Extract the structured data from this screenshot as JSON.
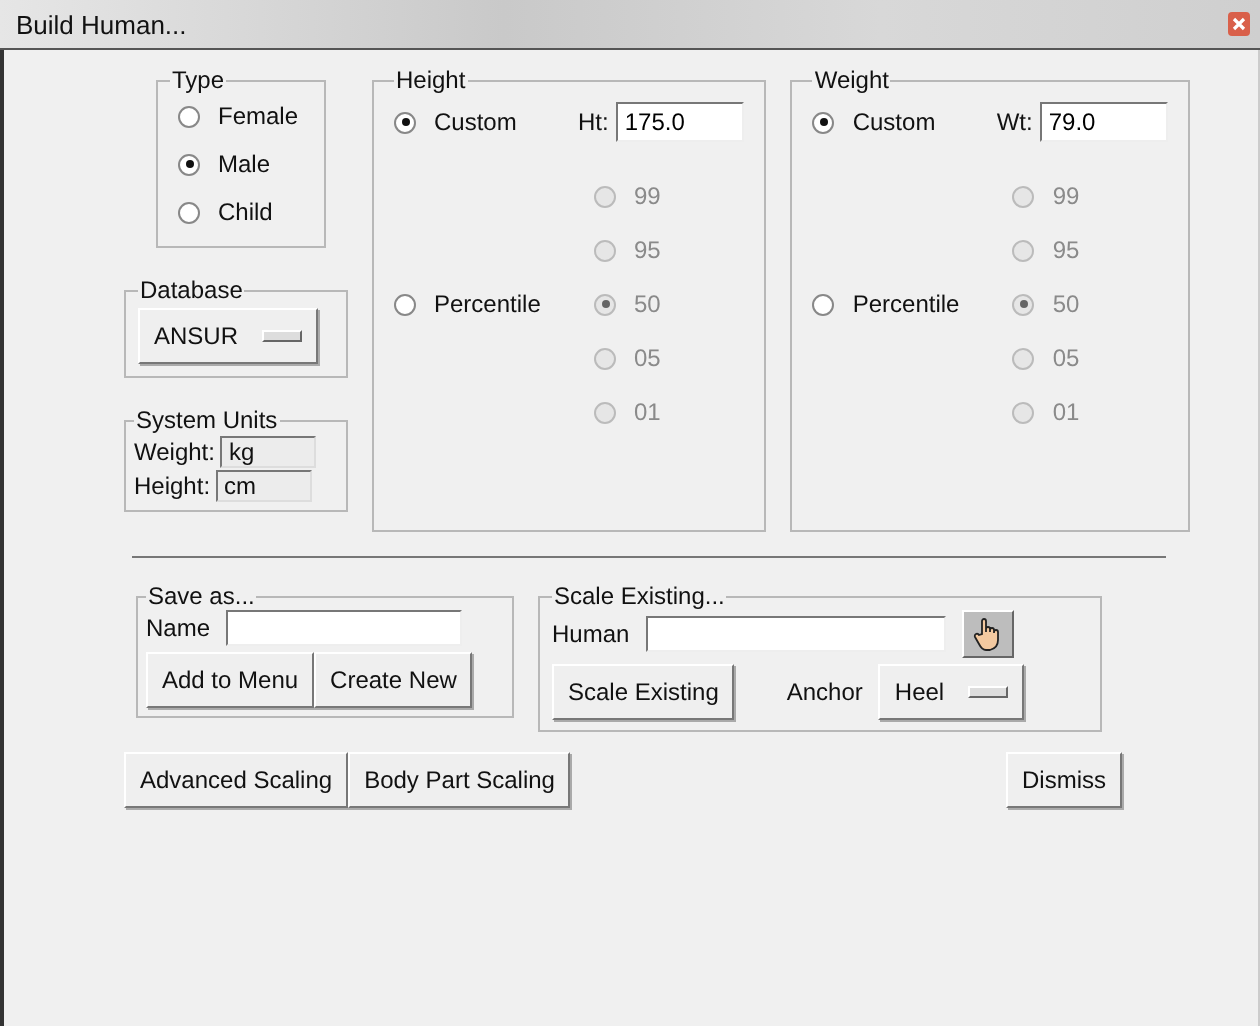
{
  "window": {
    "title": "Build Human..."
  },
  "type": {
    "legend": "Type",
    "options": [
      {
        "label": "Female",
        "selected": false
      },
      {
        "label": "Male",
        "selected": true
      },
      {
        "label": "Child",
        "selected": false
      }
    ]
  },
  "database": {
    "legend": "Database",
    "value": "ANSUR"
  },
  "system_units": {
    "legend": "System Units",
    "fields": [
      {
        "label": "Weight:",
        "value": "kg"
      },
      {
        "label": "Height:",
        "value": "cm"
      }
    ]
  },
  "measures": [
    {
      "legend": "Height",
      "custom": {
        "label": "Custom",
        "selected": true
      },
      "field_label": "Ht:",
      "value": "175.0",
      "percentile": {
        "label": "Percentile",
        "selected": false
      },
      "options": [
        {
          "label": "99",
          "selected": false,
          "disabled": true
        },
        {
          "label": "95",
          "selected": false,
          "disabled": true
        },
        {
          "label": "50",
          "selected": true,
          "disabled": true
        },
        {
          "label": "05",
          "selected": false,
          "disabled": true
        },
        {
          "label": "01",
          "selected": false,
          "disabled": true
        }
      ]
    },
    {
      "legend": "Weight",
      "custom": {
        "label": "Custom",
        "selected": true
      },
      "field_label": "Wt:",
      "value": "79.0",
      "percentile": {
        "label": "Percentile",
        "selected": false
      },
      "options": [
        {
          "label": "99",
          "selected": false,
          "disabled": true
        },
        {
          "label": "95",
          "selected": false,
          "disabled": true
        },
        {
          "label": "50",
          "selected": true,
          "disabled": true
        },
        {
          "label": "05",
          "selected": false,
          "disabled": true
        },
        {
          "label": "01",
          "selected": false,
          "disabled": true
        }
      ]
    }
  ],
  "save_as": {
    "legend": "Save as...",
    "name_label": "Name",
    "buttons": [
      "Add to Menu",
      "Create New"
    ]
  },
  "scale_existing": {
    "legend": "Scale Existing...",
    "human_label": "Human",
    "button": "Scale Existing",
    "anchor_label": "Anchor",
    "anchor_value": "Heel"
  },
  "buttons": [
    "Advanced Scaling",
    "Body Part Scaling"
  ],
  "dismiss": "Dismiss"
}
